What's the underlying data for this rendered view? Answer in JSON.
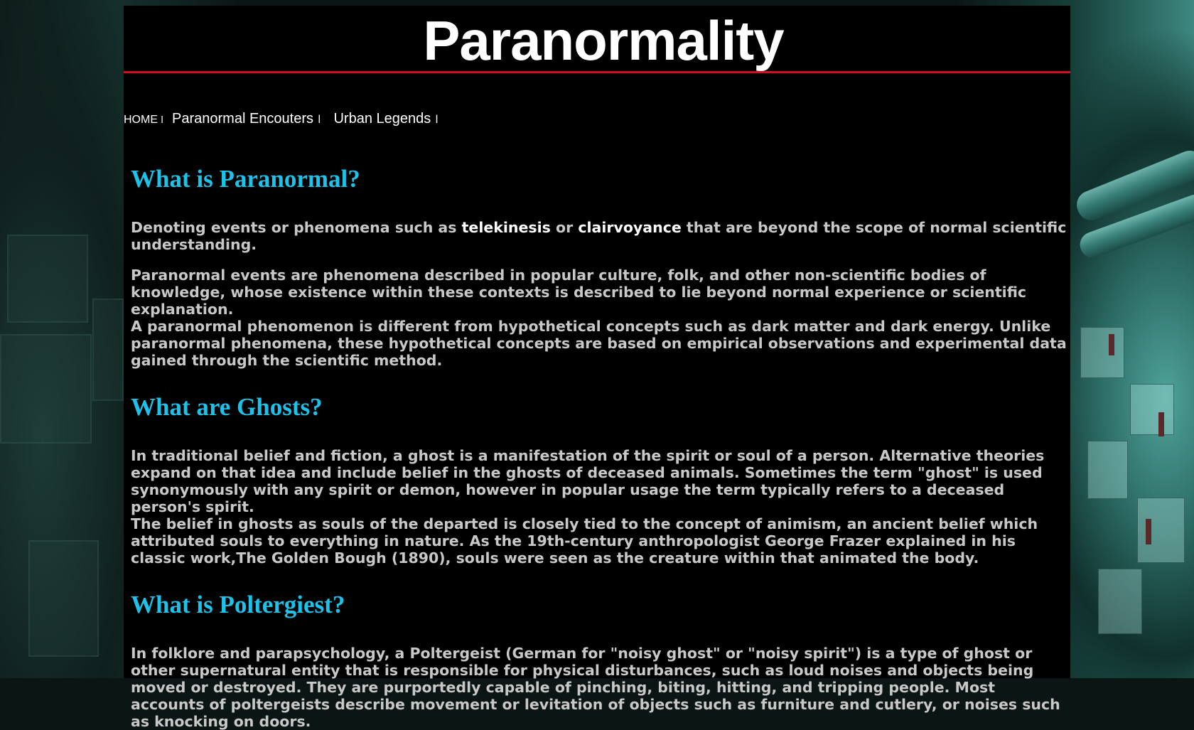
{
  "site": {
    "title": "Paranormality"
  },
  "nav": {
    "home": "HOME",
    "separator": "l",
    "items": [
      {
        "label": "Paranormal Encouters"
      },
      {
        "label": "Urban Legends"
      }
    ]
  },
  "sections": [
    {
      "heading": "What is Paranormal?",
      "intro": {
        "pre": "Denoting events or phenomena such as ",
        "term1": "telekinesis",
        "mid": " or ",
        "term2": "clairvoyance",
        "post": " that are beyond the scope of normal scientific understanding."
      },
      "paragraphs": [
        "Paranormal events are phenomena described in popular culture, folk, and other non-scientific bodies of knowledge, whose existence within these contexts is described to lie beyond normal experience or scientific explanation.",
        "A paranormal phenomenon is different from hypothetical concepts such as dark matter and dark energy. Unlike paranormal phenomena, these hypothetical concepts are based on empirical observations and experimental data gained through the scientific method."
      ]
    },
    {
      "heading": "What are Ghosts?",
      "paragraphs": [
        "In traditional belief and fiction, a ghost is a manifestation of the spirit or soul of a person. Alternative theories expand on that idea and include belief in the ghosts of deceased animals. Sometimes the term \"ghost\" is used synonymously with any spirit or demon, however in popular usage the term typically refers to a deceased person's spirit.",
        "The belief in ghosts as souls of the departed is closely tied to the concept of animism, an ancient belief which attributed souls to everything in nature. As the 19th-century anthropologist George Frazer explained in his classic work,The Golden Bough (1890), souls were seen as the creature within that animated the body."
      ]
    },
    {
      "heading": "What is Poltergiest?",
      "paragraphs": [
        "In folklore and parapsychology, a Poltergeist (German for \"noisy ghost\" or \"noisy spirit\") is a type of ghost or other supernatural entity that is responsible for physical disturbances, such as loud noises and objects being moved or destroyed. They are purportedly capable of pinching, biting, hitting, and tripping people. Most accounts of poltergeists describe movement or levitation of objects such as furniture and cutlery, or noises such as knocking on doors."
      ]
    }
  ]
}
